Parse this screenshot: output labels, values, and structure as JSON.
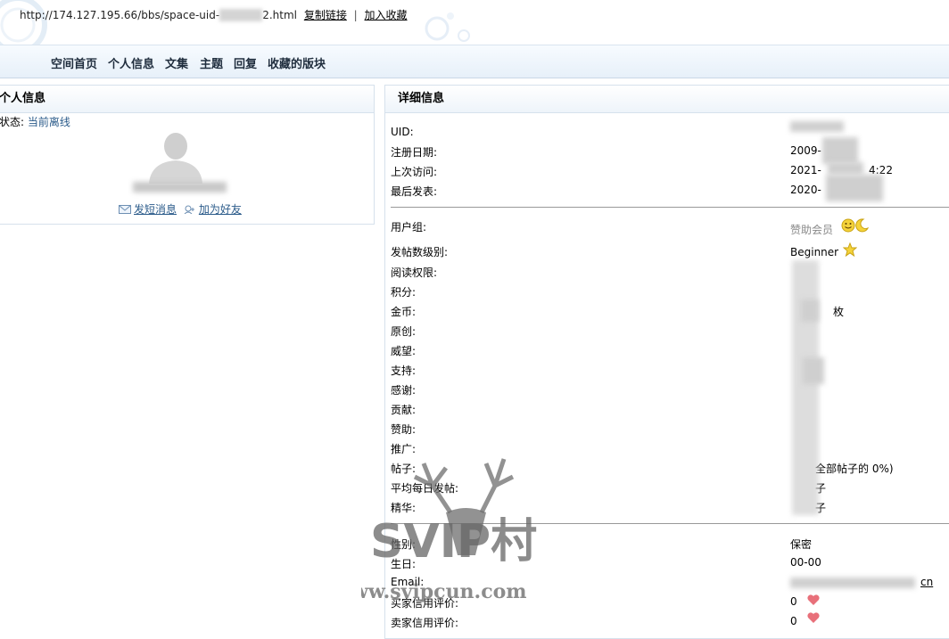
{
  "address_bar": {
    "url_prefix": "http://174.127.195.66/bbs/space-uid-",
    "url_suffix": "2.html",
    "copy_link": "复制链接",
    "separator": "|",
    "bookmark": "加入收藏"
  },
  "nav": [
    "空间首页",
    "个人信息",
    "文集",
    "主题",
    "回复",
    "收藏的版块"
  ],
  "left_panel": {
    "title": "个人信息",
    "status_label": "状态:",
    "status_value": "当前离线",
    "send_message": "发短消息",
    "add_friend": "加为好友"
  },
  "right_panel": {
    "title": "详细信息",
    "basic": [
      {
        "label": "UID:",
        "value": ""
      },
      {
        "label": "注册日期:",
        "value": "2009-"
      },
      {
        "label": "上次访问:",
        "value": "2021-",
        "value_tail": "4:22"
      },
      {
        "label": "最后发表:",
        "value": "2020-"
      }
    ],
    "group": {
      "label": "用户组:",
      "value": "赞助会员"
    },
    "level": {
      "label": "发帖数级别:",
      "value": "Beginner"
    },
    "stats": [
      {
        "label": "阅读权限:",
        "value": ""
      },
      {
        "label": "积分:",
        "value": ""
      },
      {
        "label": "金币:",
        "value": "枚"
      },
      {
        "label": "原创:",
        "value": ""
      },
      {
        "label": "威望:",
        "value": ""
      },
      {
        "label": "支持:",
        "value": ""
      },
      {
        "label": "感谢:",
        "value": ""
      },
      {
        "label": "贡献:",
        "value": ""
      },
      {
        "label": "赞助:",
        "value": ""
      },
      {
        "label": "推广:",
        "value": ""
      },
      {
        "label": "帖子:",
        "value": "全部帖子的 0%)"
      },
      {
        "label": "平均每日发帖:",
        "value": "子"
      },
      {
        "label": "精华:",
        "value": "子"
      }
    ],
    "personal": [
      {
        "label": "性别:",
        "value": "保密"
      },
      {
        "label": "生日:",
        "value": "00-00"
      },
      {
        "label": "Email:",
        "value": "cn"
      },
      {
        "label": "买家信用评价:",
        "value": "0"
      },
      {
        "label": "卖家信用评价:",
        "value": "0"
      }
    ]
  },
  "watermark": {
    "brand": "SVIP村",
    "site": "www.svipcun.com"
  },
  "colors": {
    "link": "#2b5b8a",
    "nav_bg": "#e7f0f9",
    "border": "#d6e1ec",
    "heart": "#e8707a"
  },
  "icons": [
    "user-avatar-placeholder-icon",
    "envelope-icon",
    "add-friend-icon",
    "smiley-icon",
    "moon-icon",
    "star-icon",
    "heart-icon"
  ]
}
